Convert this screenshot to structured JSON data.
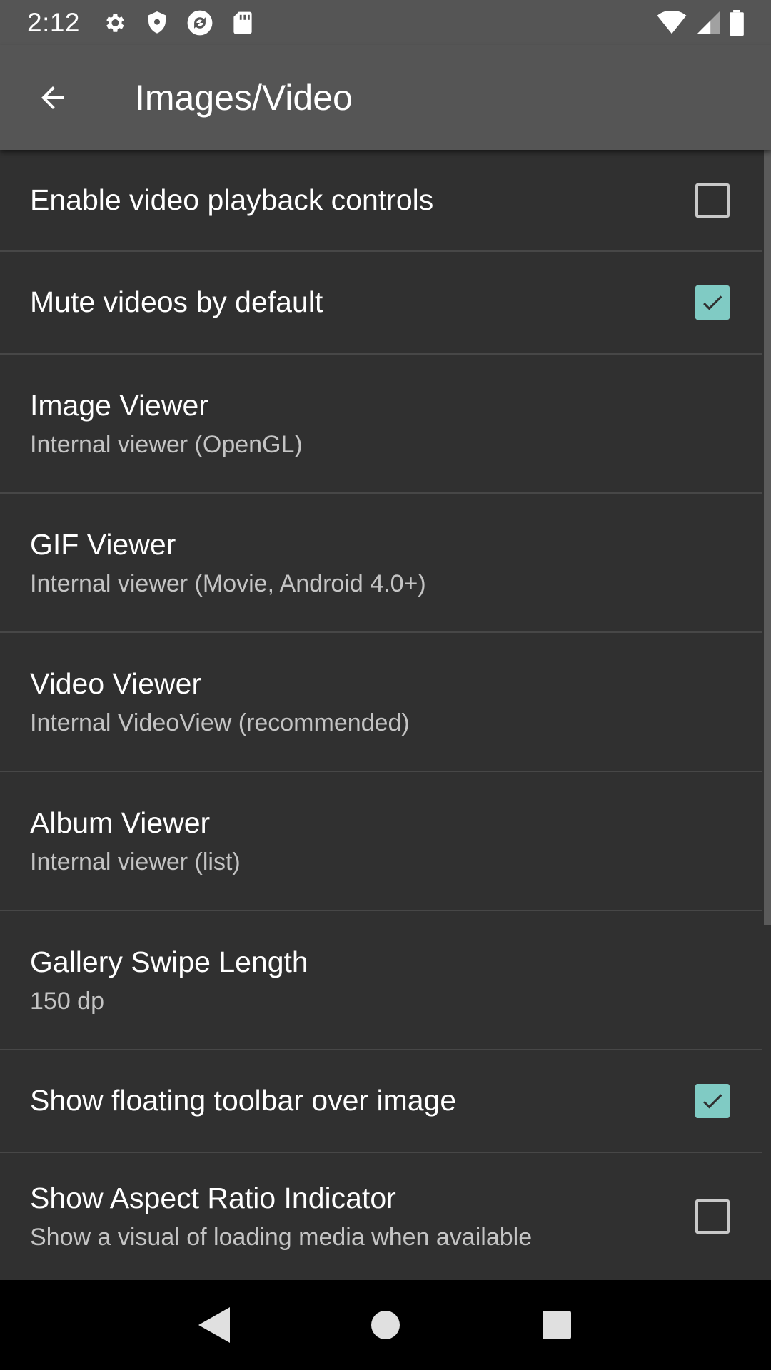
{
  "status_bar": {
    "time": "2:12",
    "left_icons": [
      "settings-icon",
      "shield-icon",
      "sync-icon",
      "sd-card-icon"
    ],
    "right_icons": [
      "wifi-icon",
      "cellular-signal-icon",
      "battery-icon"
    ]
  },
  "app_bar": {
    "title": "Images/Video",
    "back_icon": "arrow-back-icon"
  },
  "accent_color": "#80cbc4",
  "settings": [
    {
      "title": "Enable video playback controls",
      "checkbox": true,
      "checked": false
    },
    {
      "title": "Mute videos by default",
      "checkbox": true,
      "checked": true
    },
    {
      "title": "Image Viewer",
      "summary": "Internal viewer (OpenGL)"
    },
    {
      "title": "GIF Viewer",
      "summary": "Internal viewer (Movie, Android 4.0+)"
    },
    {
      "title": "Video Viewer",
      "summary": "Internal VideoView (recommended)"
    },
    {
      "title": "Album Viewer",
      "summary": "Internal viewer (list)"
    },
    {
      "title": "Gallery Swipe Length",
      "summary": "150 dp"
    },
    {
      "title": "Show floating toolbar over image",
      "checkbox": true,
      "checked": true
    },
    {
      "title": "Show Aspect Ratio Indicator",
      "summary": "Show a visual of loading media when available",
      "checkbox": true,
      "checked": false
    }
  ],
  "nav_bar": {
    "buttons": [
      "back-triangle-icon",
      "home-circle-icon",
      "recents-square-icon"
    ]
  }
}
